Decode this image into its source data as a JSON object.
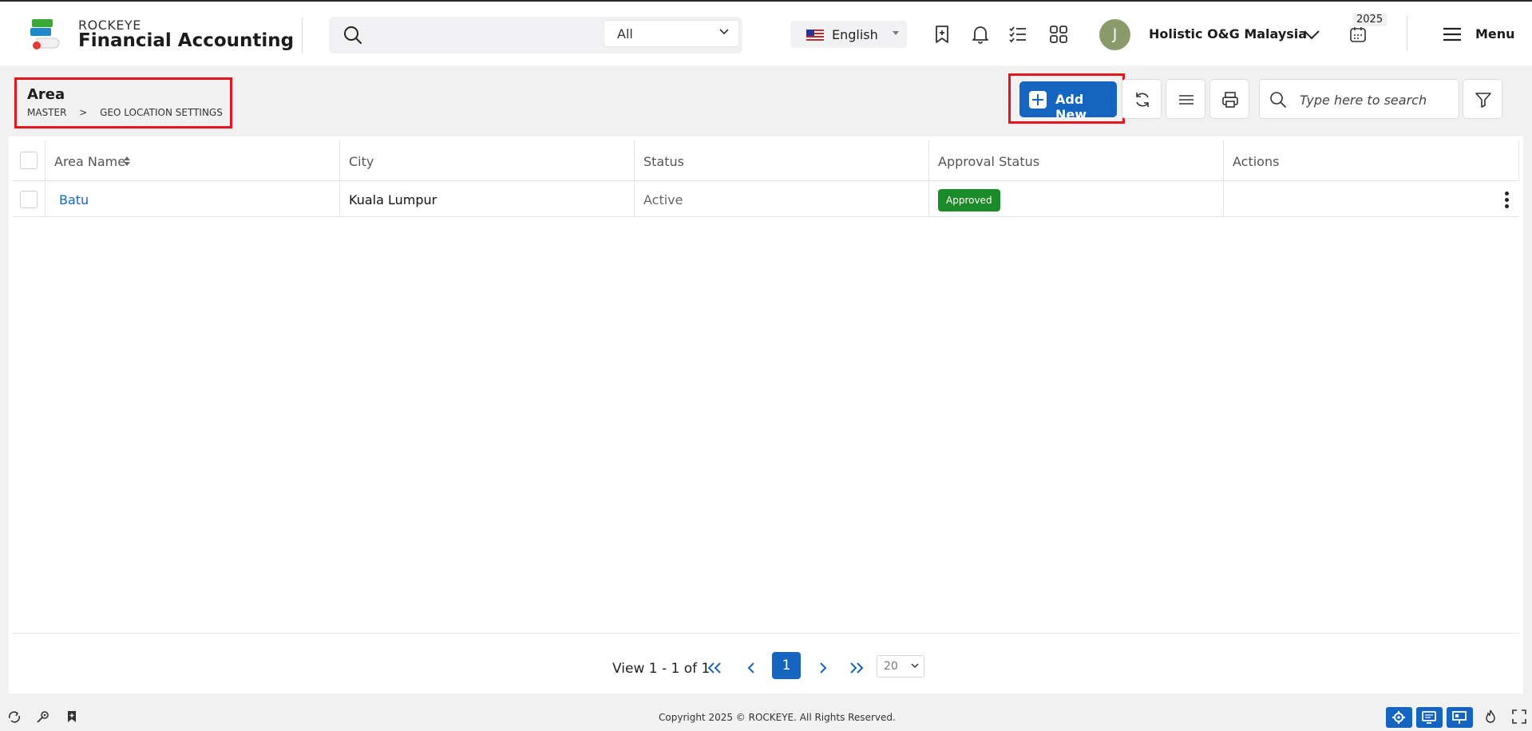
{
  "app": {
    "brand_top": "ROCKEYE",
    "brand_name": "Financial Accounting"
  },
  "header": {
    "search_scope": "All",
    "language": "English",
    "user_initial": "J",
    "company": "Holistic O&G Malaysia",
    "year": "2025",
    "menu_label": "Menu",
    "icons": [
      "search-icon",
      "chevron-down-icon",
      "us-flag-icon",
      "bookmark-add-icon",
      "bell-icon",
      "tasks-icon",
      "apps-grid-icon",
      "calendar-icon",
      "hamburger-icon"
    ]
  },
  "page": {
    "title": "Area",
    "breadcrumbs": [
      "MASTER",
      ">",
      "GEO LOCATION SETTINGS"
    ]
  },
  "toolbar": {
    "add_label": "Add New",
    "search_placeholder": "Type here to search",
    "icons": [
      "refresh-icon",
      "columns-menu-icon",
      "printer-icon",
      "search-icon",
      "filter-icon"
    ]
  },
  "table": {
    "columns": [
      "Area Name",
      "City",
      "Status",
      "Approval Status",
      "Actions"
    ],
    "rows": [
      {
        "area_name": "Batu",
        "city": "Kuala Lumpur",
        "status": "Active",
        "approval_status": "Approved"
      }
    ]
  },
  "pagination": {
    "info": "View 1 - 1 of 1",
    "current_page": "1",
    "page_size": "20"
  },
  "footer": {
    "copyright": "Copyright 2025 © ROCKEYE. All Rights Reserved.",
    "icons": [
      "recycle-icon",
      "settings-link-icon",
      "bookmark-icon",
      "gear-icon",
      "monitor-icon",
      "presentation-icon",
      "fire-icon",
      "fullscreen-icon"
    ]
  },
  "colors": {
    "primary": "#1565c0",
    "approved": "#1b8a28",
    "highlight": "#e5161b",
    "link": "#1565c0"
  }
}
